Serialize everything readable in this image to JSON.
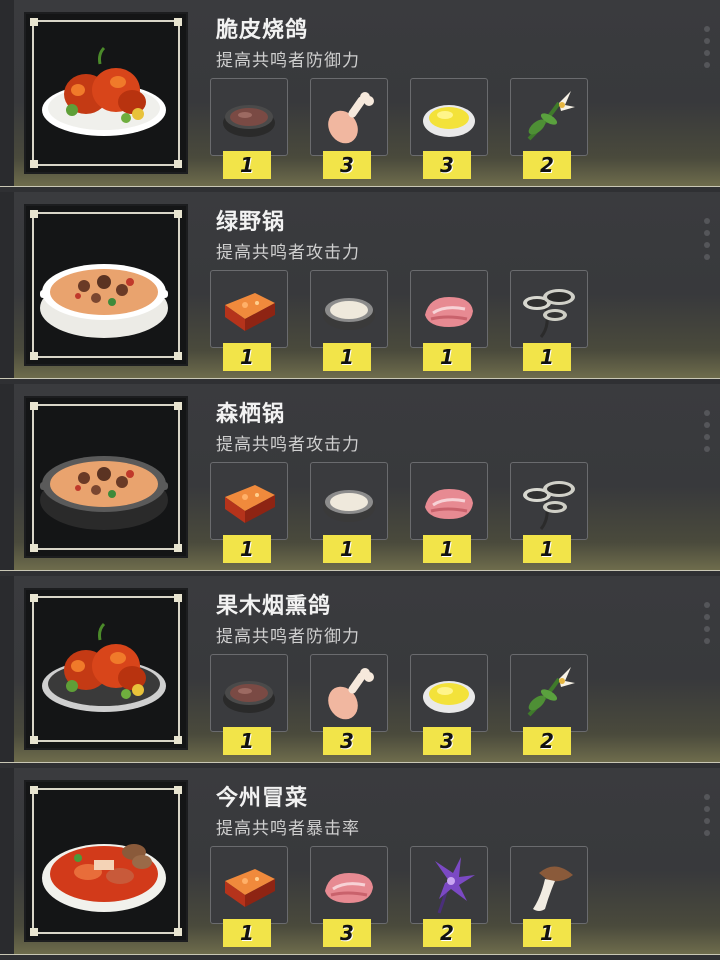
{
  "recipes": [
    {
      "name": "脆皮烧鸽",
      "desc": "提高共鸣者防御力",
      "dish": "roast-pigeon-plate-icon",
      "bowl": "#ececec",
      "ingredients": [
        {
          "icon": "sauce-bowl-icon",
          "qty": "1"
        },
        {
          "icon": "poultry-drumstick-icon",
          "qty": "3"
        },
        {
          "icon": "cooking-oil-icon",
          "qty": "3"
        },
        {
          "icon": "lily-herb-icon",
          "qty": "2"
        }
      ]
    },
    {
      "name": "绿野锅",
      "desc": "提高共鸣者攻击力",
      "dish": "stew-pot-icon",
      "bowl": "#ececec",
      "ingredients": [
        {
          "icon": "chili-paste-block-icon",
          "qty": "1"
        },
        {
          "icon": "milk-bowl-icon",
          "qty": "1"
        },
        {
          "icon": "raw-meat-icon",
          "qty": "1"
        },
        {
          "icon": "black-mushroom-icon",
          "qty": "1"
        }
      ]
    },
    {
      "name": "森栖锅",
      "desc": "提高共鸣者攻击力",
      "dish": "stew-pot-dark-icon",
      "bowl": "#2a2a2a",
      "ingredients": [
        {
          "icon": "chili-paste-block-icon",
          "qty": "1"
        },
        {
          "icon": "milk-bowl-icon",
          "qty": "1"
        },
        {
          "icon": "raw-meat-icon",
          "qty": "1"
        },
        {
          "icon": "black-mushroom-icon",
          "qty": "1"
        }
      ]
    },
    {
      "name": "果木烟熏鸽",
      "desc": "提高共鸣者防御力",
      "dish": "smoked-pigeon-plate-icon",
      "bowl": "#2a2a2a",
      "ingredients": [
        {
          "icon": "sauce-bowl-icon",
          "qty": "1"
        },
        {
          "icon": "poultry-drumstick-icon",
          "qty": "3"
        },
        {
          "icon": "cooking-oil-icon",
          "qty": "3"
        },
        {
          "icon": "lily-herb-icon",
          "qty": "2"
        }
      ]
    },
    {
      "name": "今州冒菜",
      "desc": "提高共鸣者暴击率",
      "dish": "spicy-hotpot-bowl-icon",
      "bowl": "#ececec",
      "ingredients": [
        {
          "icon": "chili-paste-block-icon",
          "qty": "1"
        },
        {
          "icon": "raw-meat-icon",
          "qty": "3"
        },
        {
          "icon": "purple-flower-icon",
          "qty": "2"
        },
        {
          "icon": "brown-mushroom-icon",
          "qty": "1"
        }
      ]
    }
  ],
  "colors": {
    "accent": "#f2e449",
    "panel": "#38393c",
    "text": "#f2f2f2"
  }
}
